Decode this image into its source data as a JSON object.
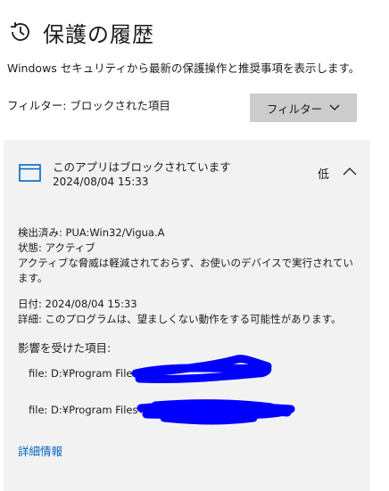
{
  "header": {
    "title": "保護の履歴",
    "icon": "history-icon"
  },
  "description": "Windows セキュリティから最新の保護操作と推奨事項を表示します。",
  "filter": {
    "label": "フィルター: ブロックされた項目",
    "button_label": "フィルター"
  },
  "event": {
    "title": "このアプリはブロックされています",
    "date": "2024/08/04 15:33",
    "severity": "低",
    "detected": "検出済み: PUA:Win32/Vigua.A",
    "status": "状態: アクティブ",
    "status_message": "アクティブな脅威は軽減されておらず、お使いのデバイスで実行されています。",
    "date_row": "日付:   2024/08/04 15:33",
    "detail_row": "詳細: このプログラムは、望ましくない動作をする可能性があります。",
    "affected_heading": "影響を受けた項目:",
    "affected_items": [
      "file: D:¥Program File",
      "file: D:¥Program Files¥"
    ],
    "more_info_link": "詳細情報"
  },
  "colors": {
    "accent": "#0067c0",
    "redaction": "#0000ff",
    "card": "#f2f2f2",
    "button": "#cccccc"
  }
}
